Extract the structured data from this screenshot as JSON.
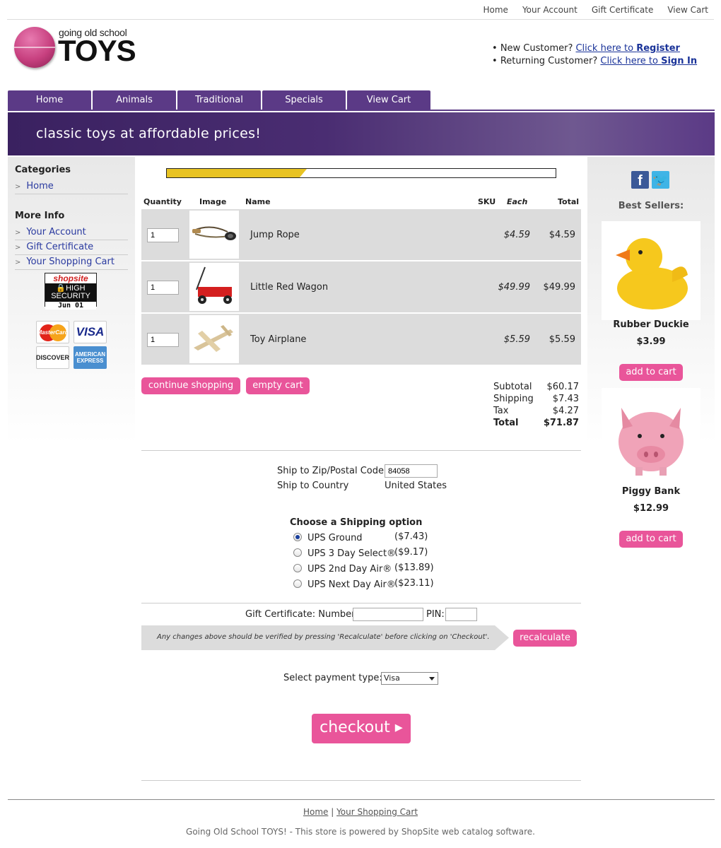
{
  "topnav": [
    "Home",
    "Your Account",
    "Gift Certificate",
    "View Cart"
  ],
  "logo": {
    "small": "going old school",
    "big": "TOYS"
  },
  "account": {
    "new_prefix": "New Customer? ",
    "new_link": "Click here to ",
    "new_bold": "Register",
    "ret_prefix": "Returning Customer? ",
    "ret_link": "Click here to ",
    "ret_bold": "Sign In"
  },
  "tabs": [
    "Home",
    "Animals",
    "Traditional",
    "Specials",
    "View Cart"
  ],
  "banner": "classic toys at affordable prices!",
  "sidebar": {
    "categories_title": "Categories",
    "categories": [
      "Home"
    ],
    "moreinfo_title": "More Info",
    "moreinfo": [
      "Your Account",
      "Gift Certificate",
      "Your Shopping Cart"
    ],
    "badge": {
      "brand": "shopsite",
      "l1": "HIGH",
      "l2": "SECURITY",
      "date": "Jun 01"
    },
    "cards": [
      "MasterCard",
      "VISA",
      "DISCOVER",
      "AMERICAN EXPRESS"
    ]
  },
  "cart": {
    "progress": 0.36,
    "headers": {
      "qty": "Quantity",
      "image": "Image",
      "name": "Name",
      "sku": "SKU",
      "each": "Each",
      "total": "Total"
    },
    "items": [
      {
        "qty": "1",
        "name": "Jump Rope",
        "each": "$4.59",
        "total": "$4.59"
      },
      {
        "qty": "1",
        "name": "Little Red Wagon",
        "each": "$49.99",
        "total": "$49.99"
      },
      {
        "qty": "1",
        "name": "Toy Airplane",
        "each": "$5.59",
        "total": "$5.59"
      }
    ],
    "continue_label": "continue shopping",
    "empty_label": "empty cart",
    "totals": {
      "subtotal_label": "Subtotal",
      "subtotal": "$60.17",
      "shipping_label": "Shipping",
      "shipping": "$7.43",
      "tax_label": "Tax",
      "tax": "$4.27",
      "total_label": "Total",
      "total": "$71.87"
    }
  },
  "shipping": {
    "zip_label": "Ship to Zip/Postal Code",
    "zip_value": "84058",
    "country_label": "Ship to Country",
    "country_value": "United States",
    "options_title": "Choose a Shipping option",
    "options": [
      {
        "label": "UPS Ground",
        "price": "($7.43)",
        "selected": true
      },
      {
        "label": "UPS 3 Day Select®",
        "price": "($9.17)",
        "selected": false
      },
      {
        "label": "UPS 2nd Day Air®",
        "price": "($13.89)",
        "selected": false
      },
      {
        "label": "UPS Next Day Air®",
        "price": "($23.11)",
        "selected": false
      }
    ]
  },
  "gift": {
    "label": "Gift Certificate: Number:",
    "pin_label": "PIN:"
  },
  "notice": "Any changes above should be verified by pressing 'Recalculate' before clicking on 'Checkout'.",
  "recalc_label": "recalculate",
  "payment": {
    "label": "Select payment type:",
    "value": "Visa"
  },
  "checkout_label": "checkout ▸",
  "rightcol": {
    "best_title": "Best Sellers:",
    "products": [
      {
        "name": "Rubber Duckie",
        "price": "$3.99",
        "button": "add to cart"
      },
      {
        "name": "Piggy Bank",
        "price": "$12.99",
        "button": "add to cart"
      }
    ]
  },
  "footer": {
    "link1": "Home",
    "sep": " | ",
    "link2": "Your Shopping Cart",
    "note": "Going Old School TOYS! - This store is powered by ShopSite web catalog software."
  },
  "colors": {
    "accent": "#5b3a86",
    "button": "#e9559a",
    "progress": "#e8c323"
  }
}
